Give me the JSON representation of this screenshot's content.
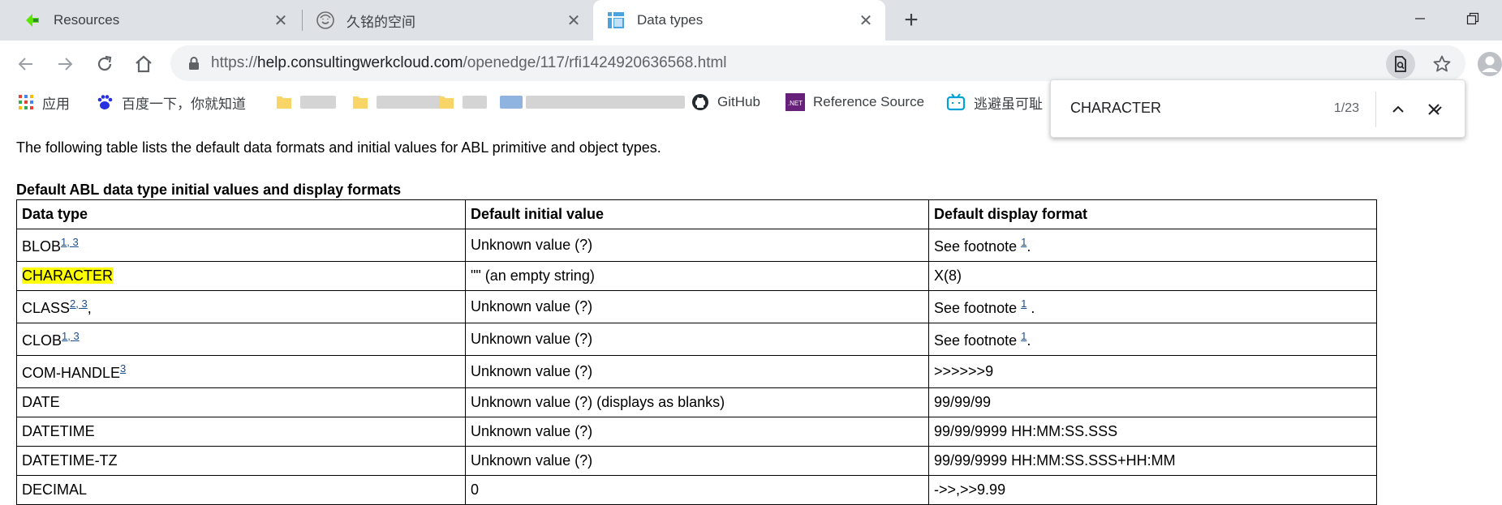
{
  "tabs": [
    {
      "title": "Resources",
      "icon": "progress-logo-icon"
    },
    {
      "title": "久铭的空间",
      "icon": "avatar-icon"
    },
    {
      "title": "Data types",
      "icon": "doc-grid-icon",
      "active": true
    }
  ],
  "address_bar": {
    "scheme": "https://",
    "host": "help.consultingwerkcloud.com",
    "path": "/openedge/117/rfi1424920636568.html"
  },
  "bookmarks": [
    {
      "label": "应用",
      "icon": "apps-grid-icon"
    },
    {
      "label": "百度一下，你就知道",
      "icon": "baidu-paw-icon"
    },
    {
      "label": "GitHub",
      "icon": "github-icon"
    },
    {
      "label": "Reference Source",
      "icon": "dotnet-icon"
    },
    {
      "label": "逃避虽可耻",
      "icon": "bilibili-icon"
    }
  ],
  "find_bar": {
    "query": "CHARACTER",
    "count": "1/23"
  },
  "page": {
    "intro": "The following table lists the default data formats and initial values for ABL primitive and object types.",
    "caption": "Default ABL data type initial values and display formats",
    "headers": [
      "Data type",
      "Default initial value",
      "Default display format"
    ],
    "rows": [
      {
        "type": "BLOB",
        "refs": "1, 3",
        "initial": "Unknown value (?)",
        "format": "See footnote ",
        "format_ref": "1",
        "format_tail": "."
      },
      {
        "type": "CHARACTER",
        "refs": "",
        "initial": "\"\" (an empty string)",
        "format": "X(8)",
        "format_ref": "",
        "format_tail": ""
      },
      {
        "type": "CLASS",
        "refs": "2, 3",
        "type_tail": ",",
        "initial": "Unknown value (?)",
        "format": "See footnote ",
        "format_ref": "1",
        "format_tail": " ."
      },
      {
        "type": "CLOB",
        "refs": "1, 3",
        "initial": "Unknown value (?)",
        "format": "See footnote ",
        "format_ref": "1",
        "format_tail": "."
      },
      {
        "type": "COM-HANDLE",
        "refs": "3",
        "initial": "Unknown value (?)",
        "format": ">>>>>>9",
        "format_ref": "",
        "format_tail": ""
      },
      {
        "type": "DATE",
        "refs": "",
        "initial": "Unknown value (?) (displays as blanks)",
        "format": "99/99/99",
        "format_ref": "",
        "format_tail": ""
      },
      {
        "type": "DATETIME",
        "refs": "",
        "initial": "Unknown value (?)",
        "format": "99/99/9999 HH:MM:SS.SSS",
        "format_ref": "",
        "format_tail": ""
      },
      {
        "type": "DATETIME-TZ",
        "refs": "",
        "initial": "Unknown value (?)",
        "format": "99/99/9999 HH:MM:SS.SSS+HH:MM",
        "format_ref": "",
        "format_tail": ""
      },
      {
        "type": "DECIMAL",
        "refs": "",
        "initial": "0",
        "format": "->>,>>9.99",
        "format_ref": "",
        "format_tail": ""
      }
    ]
  },
  "colors": {
    "find_highlight": "#ffff00",
    "link": "#1a4d8f",
    "tabstrip": "#dee1e6"
  }
}
